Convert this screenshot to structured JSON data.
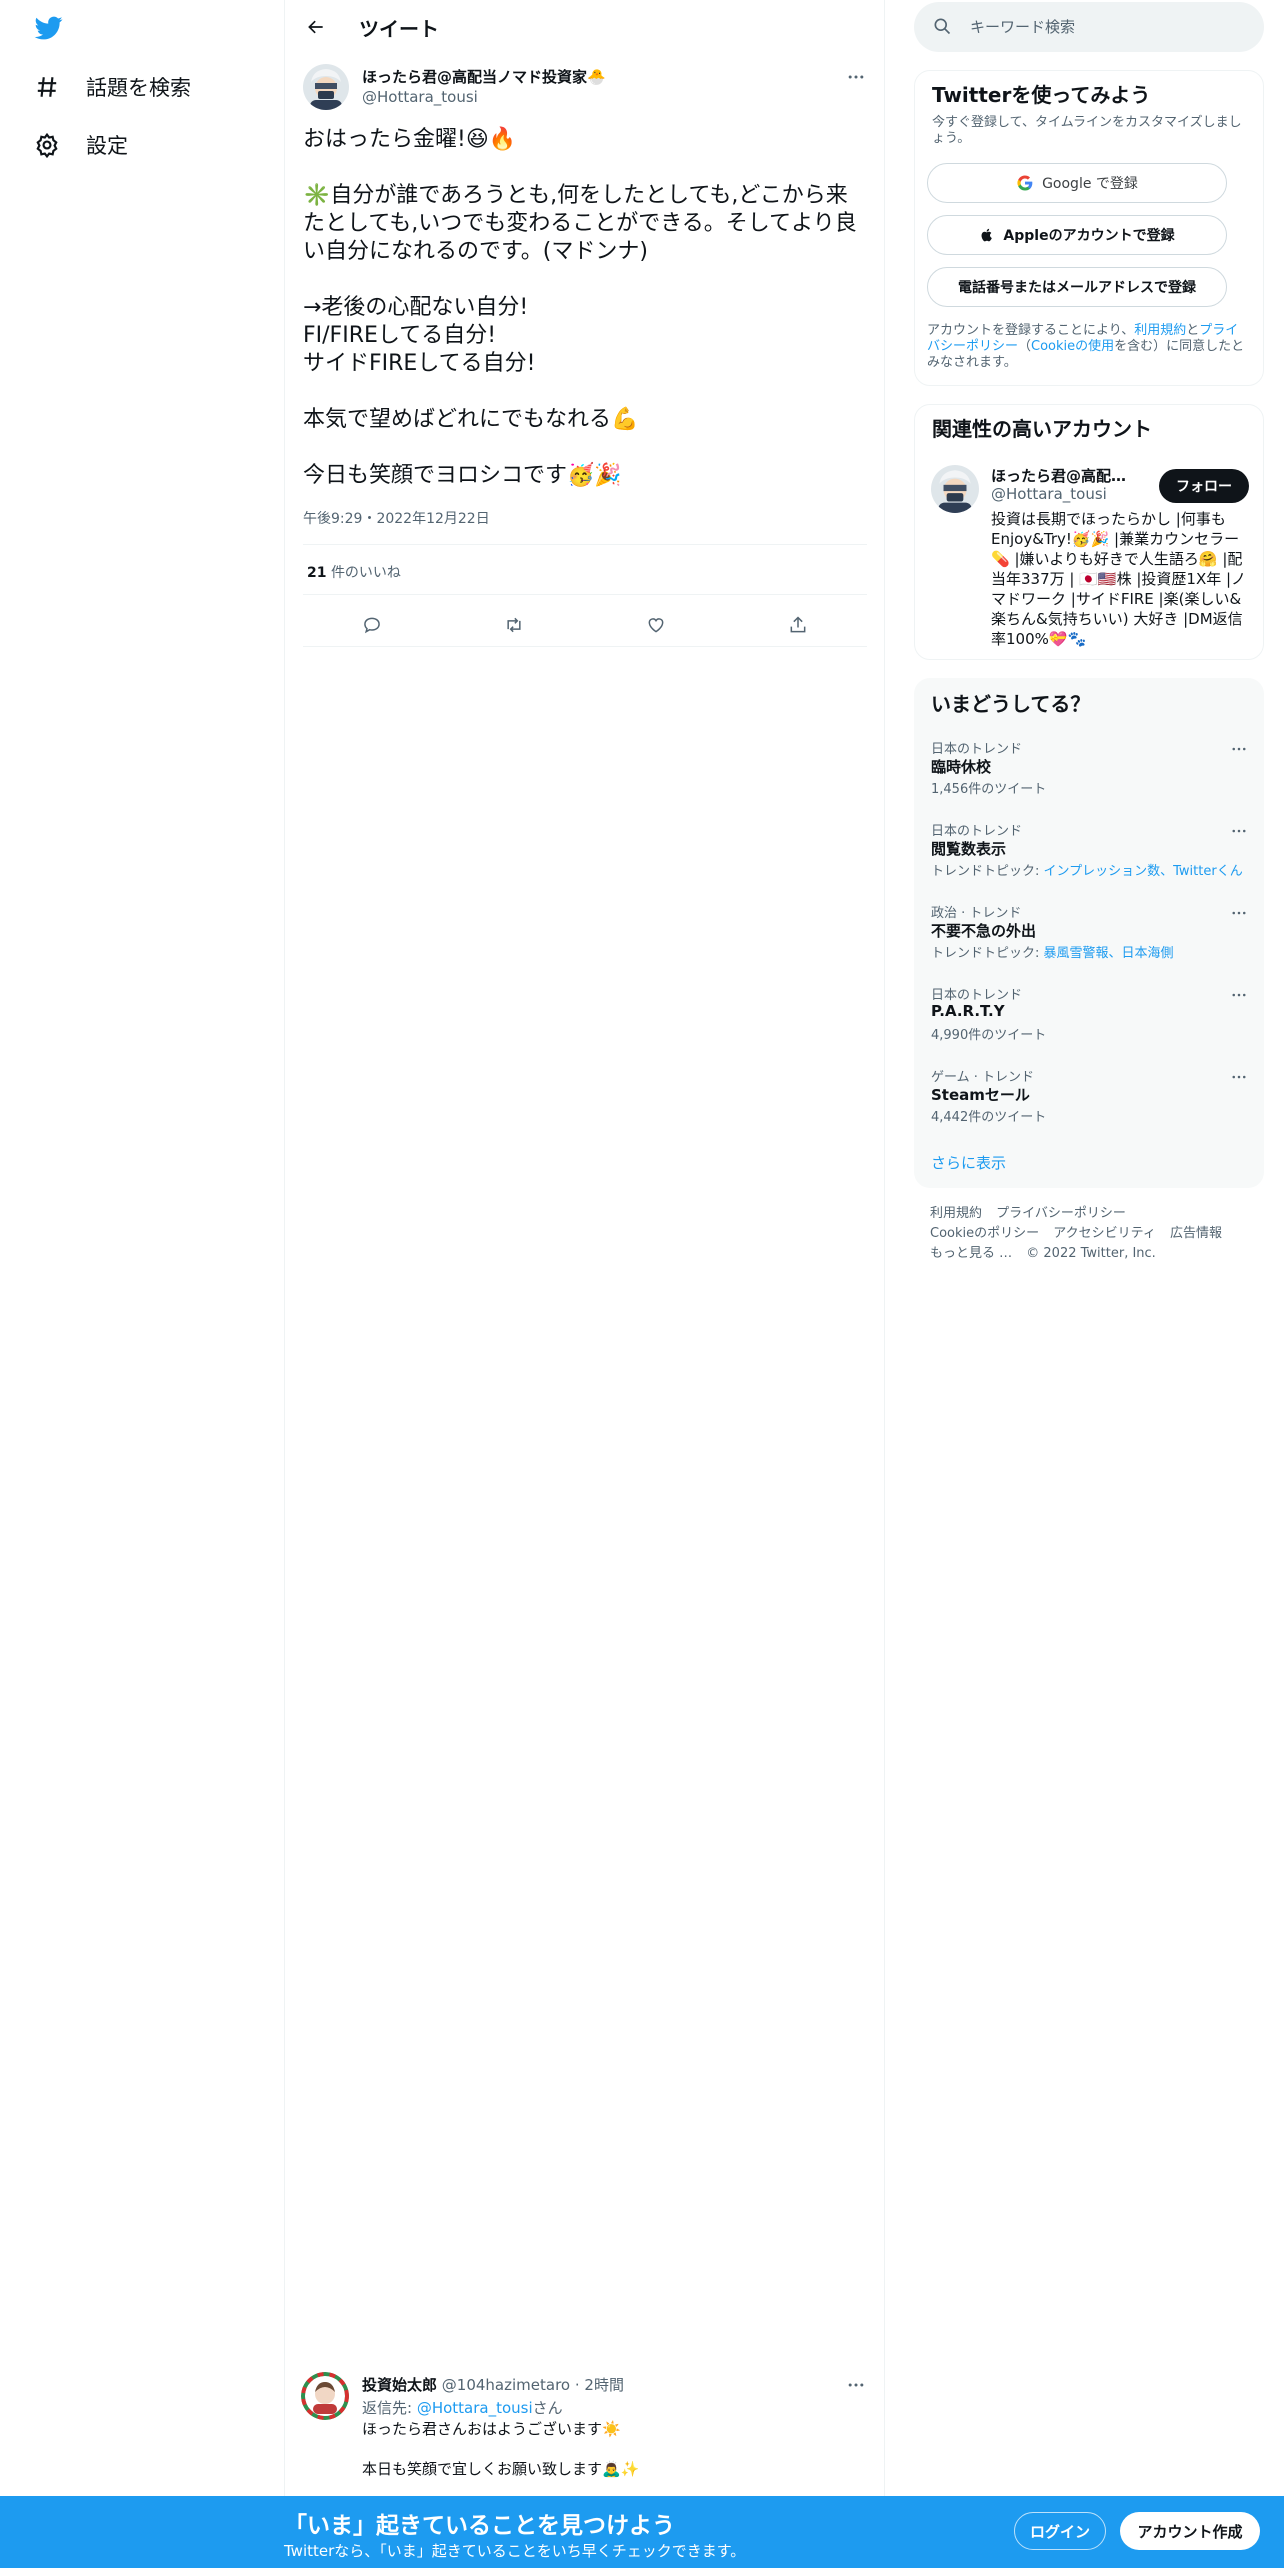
{
  "nav": {
    "items": [
      {
        "label": "話題を検索",
        "icon": "hashtag-icon"
      },
      {
        "label": "設定",
        "icon": "gear-icon"
      }
    ]
  },
  "header": {
    "title": "ツイート"
  },
  "tweet": {
    "name": "ほったら君@高配当ノマド投資家🐣",
    "handle": "@Hottara_tousi",
    "lines": [
      "おはったら金曜!😆🔥",
      "",
      "✳️自分が誰であろうとも,何をしたとしても,どこから来たとしても,いつでも変わることができる。そしてより良い自分になれるのです。(マドンナ)",
      "",
      "→老後の心配ない自分!",
      "FI/FIREしてる自分!",
      "サイドFIREしてる自分!",
      "",
      "本気で望めばどれにでもなれる💪",
      "",
      "今日も笑顔でヨロシコです🥳🎉"
    ],
    "timestamp": "午後9:29・2022年12月22日",
    "likes_count": "21",
    "likes_label": "件のいいね"
  },
  "reply": {
    "name": "投資始太郎",
    "handle_time": "@104hazimetaro · 2時間",
    "replying_prefix": "返信先: ",
    "replying_to": "@Hottara_tousi",
    "replying_suffix": "さん",
    "line1": "ほったら君さんおはようございます☀️",
    "line2": "本日も笑顔で宜しくお願い致します🙇‍♂️✨"
  },
  "search": {
    "placeholder": "キーワード検索"
  },
  "signup_card": {
    "title": "Twitterを使ってみよう",
    "subtitle": "今すぐ登録して、タイムラインをカスタマイズしましょう。",
    "google_label": "Google で登録",
    "apple_label": "Appleのアカウントで登録",
    "phone_label": "電話番号またはメールアドレスで登録",
    "terms_prefix": "アカウントを登録することにより、",
    "terms_link1": "利用規約",
    "terms_mid1": "と",
    "terms_link2": "プライバシーポリシー",
    "terms_mid2": "（",
    "terms_link3": "Cookieの使用",
    "terms_suffix": "を含む）に同意したとみなされます。"
  },
  "related": {
    "title": "関連性の高いアカウント",
    "name": "ほったら君@高配当ノマド投資家🐣",
    "handle": "@Hottara_tousi",
    "follow_label": "フォロー",
    "bio": "投資は長期でほったらかし |何事もEnjoy&Try!🥳🎉 |兼業カウンセラー💊 |嫌いよりも好きで人生語ろ🤗 |配当年337万 | 🇯🇵🇺🇸株 |投資歴1X年 |ノマドワーク |サイドFIRE |楽(楽しい&楽ちん&気持ちいい) 大好き |DM返信率100%💝🐾"
  },
  "trends": {
    "title": "いまどうしてる？",
    "items": [
      {
        "category": "日本のトレンド",
        "title": "臨時休校",
        "meta": "1,456件のツイート"
      },
      {
        "category": "日本のトレンド",
        "title": "閲覧数表示",
        "meta_prefix": "トレンドトピック: ",
        "meta_link": "インプレッション数、Twitterくん"
      },
      {
        "category": "政治 · トレンド",
        "title": "不要不急の外出",
        "meta_prefix": "トレンドトピック: ",
        "meta_link": "暴風雪警報、日本海側"
      },
      {
        "category": "日本のトレンド",
        "title": "P.A.R.T.Y",
        "meta": "4,990件のツイート"
      },
      {
        "category": "ゲーム · トレンド",
        "title": "Steamセール",
        "meta": "4,442件のツイート"
      }
    ],
    "show_more": "さらに表示"
  },
  "footer": {
    "links": [
      "利用規約",
      "プライバシーポリシー",
      "Cookieのポリシー",
      "アクセシビリティ",
      "広告情報",
      "もっと見る …"
    ],
    "copyright": "© 2022 Twitter, Inc."
  },
  "bottombar": {
    "title": "「いま」起きていることを見つけよう",
    "subtitle": "Twitterなら、「いま」起きていることをいち早くチェックできます。",
    "login": "ログイン",
    "signup": "アカウント作成"
  },
  "colors": {
    "brand": "#1d9bf0",
    "text": "#0f1419",
    "secondary": "#536471",
    "border": "#eff3f4"
  }
}
